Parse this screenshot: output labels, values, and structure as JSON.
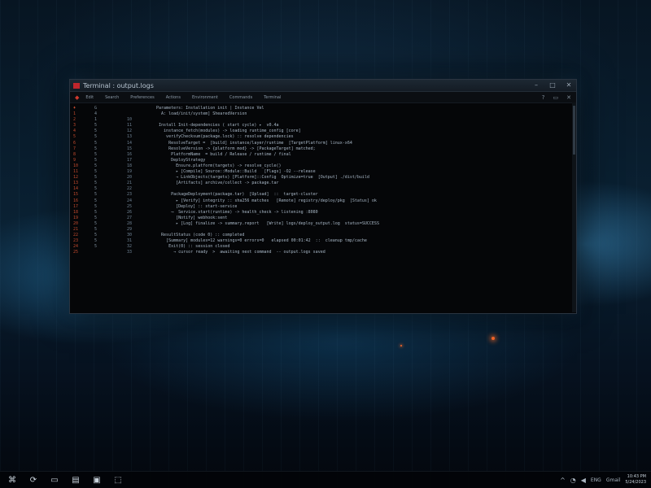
{
  "window": {
    "title": "Terminal : output.logs",
    "controls": {
      "minimize": "–",
      "maximize": "□",
      "close": "✕"
    }
  },
  "menubar": {
    "items": [
      "Edit",
      "Search",
      "Preferences",
      "Actions",
      "Environment",
      "Commands",
      "Terminal"
    ],
    "right_icons": [
      "?",
      "▭",
      "✕"
    ]
  },
  "terminal": {
    "lines": [
      {
        "g1": "♦",
        "g2": "G",
        "g3": "",
        "text": "  Parameters: Installation init | Instance Vel"
      },
      {
        "g1": "1",
        "g2": "4",
        "g3": "",
        "text": "    A: load/init/system] ShearedVersion"
      },
      {
        "g1": "2",
        "g2": "1",
        "g3": "10",
        "text": " "
      },
      {
        "g1": "3",
        "g2": "5",
        "g3": "11",
        "text": "   Install Init-dependencies ( start cycle) ▸  v0.4a"
      },
      {
        "g1": "4",
        "g2": "5",
        "g3": "12",
        "text": "     instance_fetch(modules) -> loading runtime_config [core]"
      },
      {
        "g1": "5",
        "g2": "5",
        "g3": "13",
        "text": "      verifyChecksum(package.lock) :: resolve dependencies"
      },
      {
        "g1": "6",
        "g2": "5",
        "g3": "14",
        "text": "       ResolveTarget =  [build] instance/layer/runtime  [TargetPlatform] linux-x64"
      },
      {
        "g1": "7",
        "g2": "5",
        "g3": "15",
        "text": "       ResolveVersion -> {platform mod} -> [PackageTarget] matched;"
      },
      {
        "g1": "8",
        "g2": "5",
        "g3": "16",
        "text": "        PlatformName  = build / Release / runtime / final"
      },
      {
        "g1": "9",
        "g2": "5",
        "g3": "17",
        "text": "        DeployStrategy"
      },
      {
        "g1": "10",
        "g2": "5",
        "g3": "18",
        "text": "          Ensure.platform(targets) -> resolve_cycle()"
      },
      {
        "g1": "11",
        "g2": "5",
        "g3": "19",
        "text": "          ▸ [Compile] Source::Module::Build   [Flags] -O2 --release"
      },
      {
        "g1": "12",
        "g2": "5",
        "g3": "20",
        "text": "          → LinkObjects(targets) [Platform]::Config  Optimize=true  [Output] ./dist/build"
      },
      {
        "g1": "13",
        "g2": "5",
        "g3": "21",
        "text": "          [Artifacts] archive/collect -> package.tar"
      },
      {
        "g1": "14",
        "g2": "5",
        "g3": "22",
        "text": " "
      },
      {
        "g1": "15",
        "g2": "5",
        "g3": "23",
        "text": "        PackageDeployment(package.tar)  [Upload]  ::  target-cluster"
      },
      {
        "g1": "16",
        "g2": "5",
        "g3": "24",
        "text": "          ▸ [Verify] integrity :: sha256 matches   [Remote] registry/deploy/pkg  [Status] ok"
      },
      {
        "g1": "17",
        "g2": "5",
        "g3": "25",
        "text": "          [Deploy] :: start-service"
      },
      {
        "g1": "18",
        "g2": "5",
        "g3": "26",
        "text": "        ⟶  Service.start(runtime) -> health_check -> listening :8080"
      },
      {
        "g1": "19",
        "g2": "5",
        "g3": "27",
        "text": "          [Notify] webhook:sent"
      },
      {
        "g1": "20",
        "g2": "5",
        "g3": "28",
        "text": "          ▸ [Log] finalize -> summary.report   [Write] logs/deploy_output.log  status=SUCCESS"
      },
      {
        "g1": "21",
        "g2": "5",
        "g3": "29",
        "text": "       "
      },
      {
        "g1": "22",
        "g2": "5",
        "g3": "30",
        "text": "    ResultStatus (code 0) :: completed"
      },
      {
        "g1": "23",
        "g2": "5",
        "g3": "31",
        "text": "      [Summary] modules=12 warnings=0 errors=0   elapsed 00:01:42  ::  cleanup tmp/cache"
      },
      {
        "g1": "24",
        "g2": "5",
        "g3": "32",
        "text": "       Exit(0) :: session closed"
      },
      {
        "g1": "25",
        "g2": "",
        "g3": "33",
        "text": "         → cursor ready  >  awaiting next command  -- output.logs saved"
      }
    ]
  },
  "taskbar": {
    "buttons": [
      {
        "name": "start",
        "glyph": "⌘"
      },
      {
        "name": "search",
        "glyph": "⟳"
      },
      {
        "name": "file-explorer",
        "glyph": "▭"
      },
      {
        "name": "folder",
        "glyph": "▤"
      },
      {
        "name": "terminal-app",
        "glyph": "▣"
      },
      {
        "name": "app",
        "glyph": "⬚"
      }
    ],
    "tray": {
      "chevron": "^",
      "network": "◔",
      "volume": "◀",
      "lang": "ENG",
      "notice": "Gmail",
      "time": "10:43 PM",
      "date": "5/24/2023"
    }
  }
}
